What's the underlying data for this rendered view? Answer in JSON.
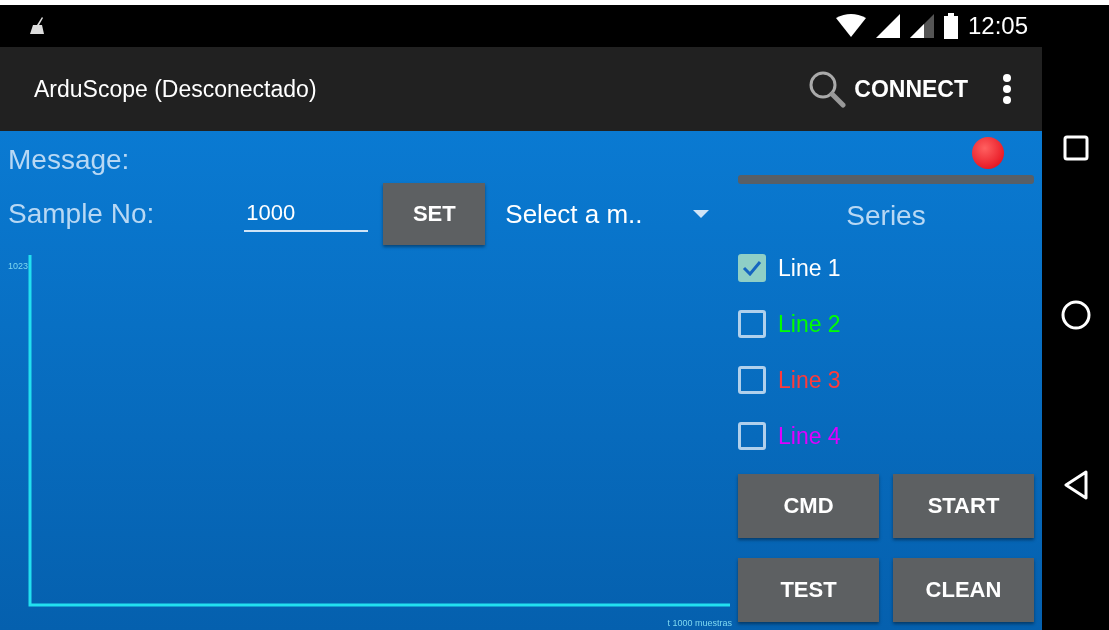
{
  "status_bar": {
    "time": "12:05"
  },
  "app_bar": {
    "title": "ArduScope (Desconectado)",
    "action": "CONNECT"
  },
  "message": {
    "label": "Message:"
  },
  "sample": {
    "label": "Sample No:",
    "value": "1000",
    "button": "SET",
    "select": "Select a m.."
  },
  "plot": {
    "y_label": "1023",
    "x_label": "t  1000 muestras"
  },
  "series": {
    "title": "Series",
    "items": [
      {
        "label": "Line 1",
        "checked": true,
        "color": "#ffffff"
      },
      {
        "label": "Line 2",
        "checked": false,
        "color": "#00ff00"
      },
      {
        "label": "Line 3",
        "checked": false,
        "color": "#ff3a3a"
      },
      {
        "label": "Line 4",
        "checked": false,
        "color": "#dd00ff"
      }
    ]
  },
  "buttons": [
    "CMD",
    "START",
    "TEST",
    "CLEAN"
  ]
}
